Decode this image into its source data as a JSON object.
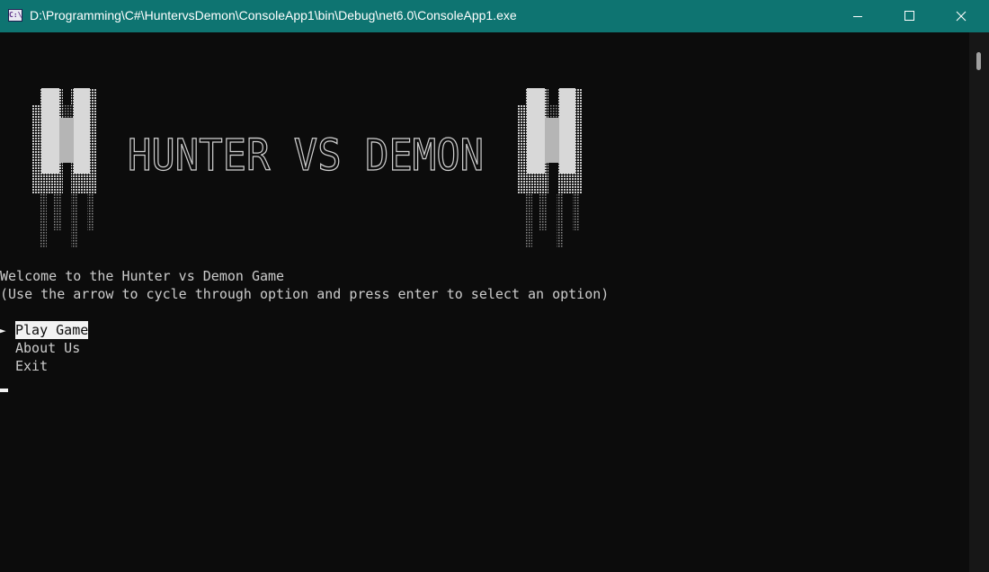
{
  "window": {
    "title": "D:\\Programming\\C#\\HuntervsDemon\\ConsoleApp1\\bin\\Debug\\net6.0\\ConsoleApp1.exe",
    "icon_text": "C:\\",
    "icon": "console-app-icon",
    "controls": [
      "minimize-icon",
      "maximize-icon",
      "close-icon"
    ]
  },
  "banner": {
    "ascii_title": "HUNTER VS DEMON",
    "left_art": "hunter-ascii-art",
    "right_art": "demon-ascii-art"
  },
  "console": {
    "welcome": "Welcome to the Hunter vs Demon Game",
    "instructions": "(Use the arrow to cycle through option and press enter to select an option)",
    "pointer": "►",
    "menu": [
      {
        "label": "Play Game",
        "selected": true
      },
      {
        "label": "About Us",
        "selected": false
      },
      {
        "label": "Exit",
        "selected": false
      }
    ]
  },
  "colors": {
    "titlebar": "#0e7471",
    "background": "#0c0c0c",
    "text": "#cccccc",
    "highlight": "#f2f2f2"
  }
}
